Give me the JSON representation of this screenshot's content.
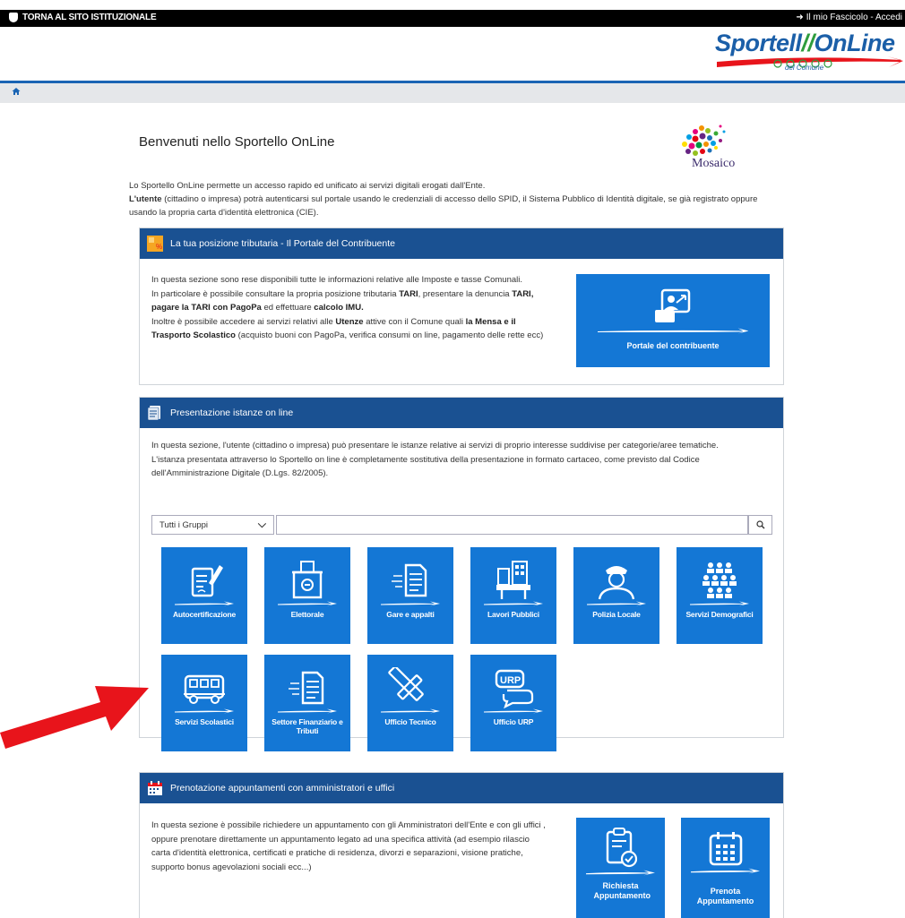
{
  "topbar": {
    "back_link": "TORNA AL SITO ISTITUZIONALE",
    "account_link": "Il mio Fascicolo - Accedi"
  },
  "logo": {
    "text_part1": "Sportell",
    "text_part2": "OnLine",
    "sub": "del Comune"
  },
  "breadcrumb": {
    "home_icon": "home-icon"
  },
  "welcome": {
    "title": "Benvenuti nello Sportello OnLine",
    "mosaico_label": "Mosaico",
    "intro_line1": "Lo Sportello OnLine permette un accesso rapido ed unificato ai servizi digitali erogati dall'Ente.",
    "intro_bold": "L'utente",
    "intro_line2": " (cittadino o impresa) potrà autenticarsi sul portale usando le credenziali di accesso dello SPID, il Sistema Pubblico di Identità digitale, se già registrato oppure usando la propria carta d'identità elettronica (CIE)."
  },
  "panel_tributi": {
    "title": "La tua posizione tributaria - Il Portale del Contribuente",
    "line1": "In questa sezione sono rese disponibili tutte le informazioni relative alle Imposte e tasse Comunali.",
    "line2a": "In particolare è possibile consultare la propria posizione tributaria ",
    "line2b": "TARI",
    "line2c": ", presentare la denuncia ",
    "line2d": "TARI,",
    "line3a": "pagare la TARI con PagoPa",
    "line3b": " ed effettuare ",
    "line3c": "calcolo IMU.",
    "line4a": "Inoltre è possibile accedere ai servizi relativi alle ",
    "line4b": "Utenze",
    "line4c": " attive con il Comune quali ",
    "line4d": "la Mensa e il",
    "line5a": "Trasporto Scolastico",
    "line5b": " (acquisto buoni con PagoPa, verifica consumi on line, pagamento delle rette ecc)",
    "button_label": "Portale del contribuente"
  },
  "panel_istanze": {
    "title": "Presentazione istanze on line",
    "line1": "In questa sezione, l'utente (cittadino o impresa) può presentare le istanze relative ai servizi di proprio interesse suddivise per categorie/aree tematiche.",
    "line2": "L'istanza presentata attraverso lo Sportello on line è completamente sostitutiva della presentazione in formato cartaceo, come previsto dal Codice",
    "line3": "dell'Amministrazione Digitale (D.Lgs. 82/2005).",
    "group_select": "Tutti i Gruppi",
    "search_placeholder": "",
    "tiles": [
      {
        "label": "Autocertificazione",
        "icon": "document-pen-icon"
      },
      {
        "label": "Elettorale",
        "icon": "ballot-box-icon"
      },
      {
        "label": "Gare e appalti",
        "icon": "fast-document-icon"
      },
      {
        "label": "Lavori Pubblici",
        "icon": "construction-icon"
      },
      {
        "label": "Polizia Locale",
        "icon": "police-officer-icon"
      },
      {
        "label": "Servizi Demografici",
        "icon": "people-group-icon"
      },
      {
        "label": "Servizi Scolastici",
        "icon": "school-bus-icon"
      },
      {
        "label": "Settore Finanziario e Tributi",
        "icon": "fast-document-icon"
      },
      {
        "label": "Ufficio Tecnico",
        "icon": "ruler-pencil-icon"
      },
      {
        "label": "Ufficio URP",
        "icon": "urp-speech-icon"
      }
    ]
  },
  "panel_appuntamenti": {
    "title": "Prenotazione appuntamenti con amministratori e uffici",
    "line1": "In questa sezione è possibile richiedere un appuntamento con gli Amministratori dell'Ente e con gli uffici ,",
    "line2": "oppure prenotare direttamente un appuntamento legato ad una specifica attività (ad esempio rilascio",
    "line3": "carta d'identità elettronica, certificati e pratiche di residenza, divorzi e separazioni, visione pratiche,",
    "line4": "supporto bonus agevolazioni sociali ecc...)",
    "button1": "Richiesta Appuntamento",
    "button2": "Prenota Appuntamento"
  },
  "colors": {
    "header_blue": "#1a5192",
    "tile_blue": "#1477d5",
    "arrow_red": "#e8141b"
  }
}
